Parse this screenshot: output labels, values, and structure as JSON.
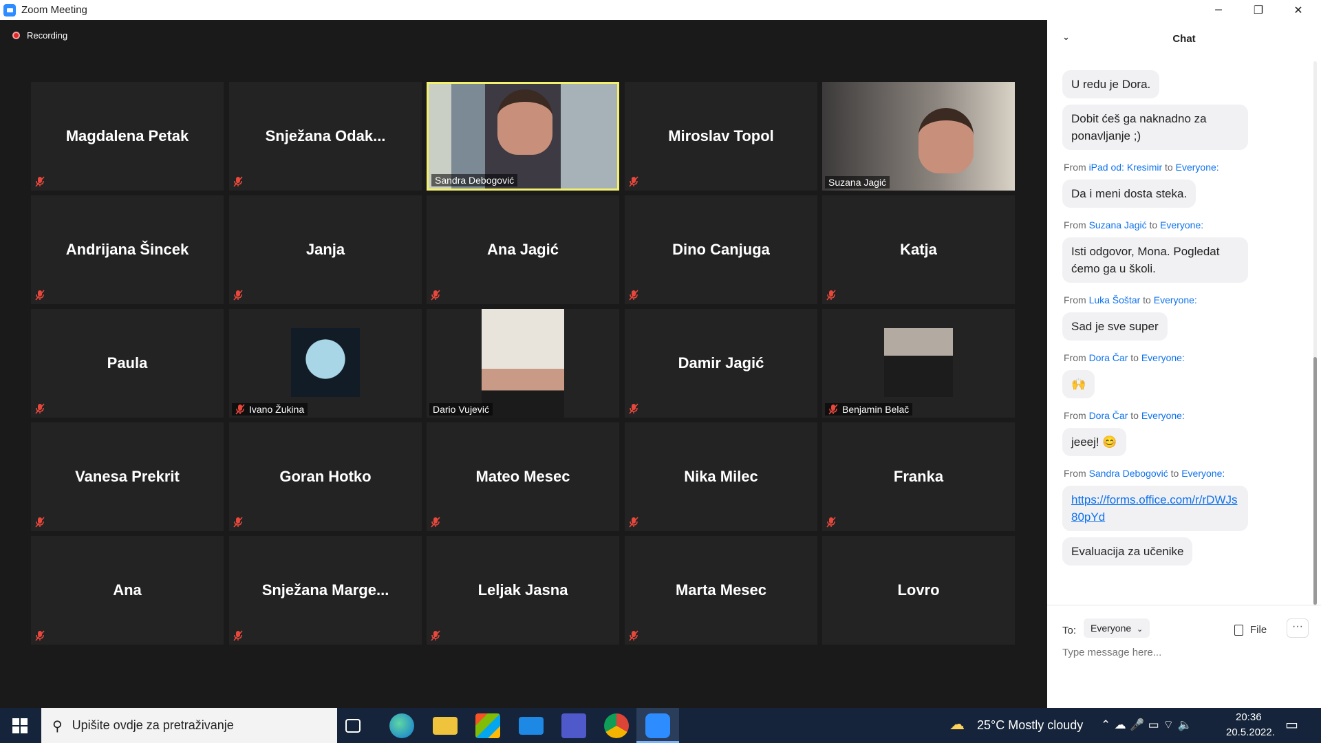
{
  "window": {
    "title": "Zoom Meeting"
  },
  "meeting": {
    "recording_label": "Recording",
    "participants": [
      {
        "name": "Magdalena Petak",
        "video": false
      },
      {
        "name": "Snježana  Odak...",
        "video": false
      },
      {
        "name": "Sandra Debogović",
        "video": true,
        "active_speaker": true
      },
      {
        "name": "Miroslav Topol",
        "video": false
      },
      {
        "name": "Suzana Jagić",
        "video": true
      },
      {
        "name": "Andrijana Šincek",
        "video": false
      },
      {
        "name": "Janja",
        "video": false
      },
      {
        "name": "Ana Jagić",
        "video": false
      },
      {
        "name": "Dino Canjuga",
        "video": false
      },
      {
        "name": "Katja",
        "video": false
      },
      {
        "name": "Paula",
        "video": false
      },
      {
        "name": "Ivano Žukina",
        "video": false,
        "avatar": true
      },
      {
        "name": "Dario Vujević",
        "video": true
      },
      {
        "name": "Damir Jagić",
        "video": false
      },
      {
        "name": "Benjamin Belač",
        "video": false,
        "avatar": true
      },
      {
        "name": "Vanesa Prekrit",
        "video": false
      },
      {
        "name": "Goran Hotko",
        "video": false
      },
      {
        "name": "Mateo Mesec",
        "video": false
      },
      {
        "name": "Nika Milec",
        "video": false
      },
      {
        "name": "Franka",
        "video": false
      },
      {
        "name": "Ana",
        "video": false
      },
      {
        "name": "Snježana  Marge...",
        "video": false
      },
      {
        "name": "Leljak Jasna",
        "video": false
      },
      {
        "name": "Marta Mesec",
        "video": false
      },
      {
        "name": "Lovro",
        "video": false
      }
    ]
  },
  "chat": {
    "title": "Chat",
    "from_word": "From",
    "to_word": "to",
    "messages": [
      {
        "from": "",
        "to": "",
        "text": "U redu je Dora."
      },
      {
        "from": "",
        "to": "",
        "text": "Dobit ćeš ga naknadno za ponavljanje ;)"
      },
      {
        "from": "iPad od: Kresimir",
        "to": "Everyone:",
        "text": "Da i meni dosta steka."
      },
      {
        "from": "Suzana Jagić",
        "to": "Everyone:",
        "text": "Isti odgovor, Mona. Pogledat ćemo ga u školi."
      },
      {
        "from": "Luka Šoštar",
        "to": "Everyone:",
        "text": "Sad je sve super"
      },
      {
        "from": "Dora Čar",
        "to": "Everyone:",
        "text": "🙌"
      },
      {
        "from": "Dora Čar",
        "to": "Everyone:",
        "text": "jeeej! 😊"
      },
      {
        "from": "Sandra Debogović",
        "to": "Everyone:",
        "text": "https://forms.office.com/r/rDWJs80pYd",
        "link": true
      },
      {
        "from": "",
        "to": "",
        "text": "Evaluacija za učenike"
      }
    ],
    "to_label": "To:",
    "recipient": "Everyone",
    "file_label": "File",
    "more_label": "···",
    "input_placeholder": "Type message here..."
  },
  "taskbar": {
    "search_placeholder": "Upišite ovdje za pretraživanje",
    "weather": "25°C  Mostly cloudy",
    "time": "20:36",
    "date": "20.5.2022."
  }
}
